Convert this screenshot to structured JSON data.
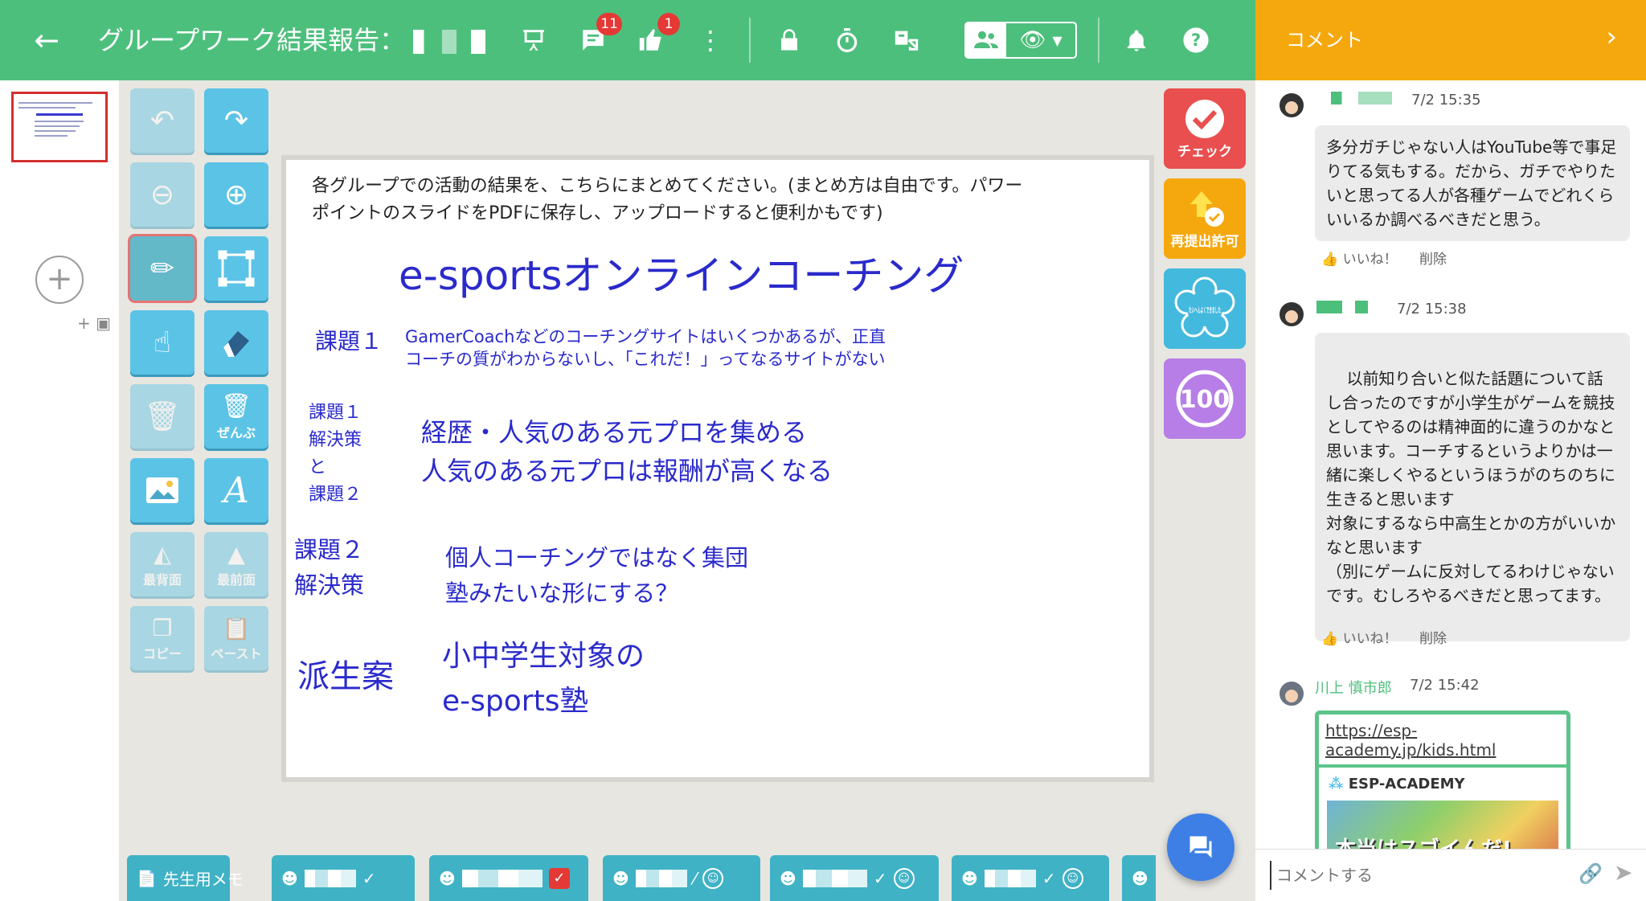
{
  "header": {
    "title": "グループワーク結果報告：",
    "comments_badge": "11",
    "likes_badge": "1",
    "panel_title": "コメント",
    "icons": [
      "back-arrow-icon",
      "presentation-icon",
      "comment-icon",
      "thumbs-up-icon",
      "more-vert-icon",
      "lock-icon",
      "timer-icon",
      "translate-off-icon",
      "group-icon",
      "eye-icon",
      "bell-icon",
      "help-icon"
    ]
  },
  "tools": {
    "delete_all": "ぜんぶ",
    "send_back": "最背面",
    "bring_front": "最前面",
    "copy": "コピー",
    "paste": "ペースト"
  },
  "right_tools": {
    "check": "チェック",
    "resubmit": "再提出許可",
    "stamp": "たいへんよくできました",
    "score": "100"
  },
  "canvas": {
    "intro_line1": "各グループでの活動の結果を、こちらにまとめてください。(まとめ方は自由です。パワー",
    "intro_line2": "ポイントのスライドをPDFに保存し、アップロードすると便利かもです)",
    "heading": "e-sportsオンラインコーチング",
    "issue1_label": "課題１",
    "issue1_line1": "GamerCoachなどのコーチングサイトはいくつかあるが、正直",
    "issue1_line2": "コーチの質がわからないし、「これだ！」ってなるサイトがない",
    "sol1_label_1": "課題１",
    "sol1_label_2": "解決策",
    "sol1_label_3": "と",
    "sol1_label_4": "課題２",
    "sol1_line1": "経歴・人気のある元プロを集める",
    "sol1_line2": "人気のある元プロは報酬が高くなる",
    "sol2_label_1": "課題２",
    "sol2_label_2": "解決策",
    "sol2_line1": "個人コーチングではなく集団",
    "sol2_line2": "塾みたいな形にする？",
    "deriv_label": "派生案",
    "deriv_line1": "小中学生対象の",
    "deriv_line2": "e-sports塾"
  },
  "comments": [
    {
      "time": "7/2 15:35",
      "text": "多分ガチじゃない人はYouTube等で事足りてる気もする。だから、ガチでやりたいと思ってる人が各種ゲームでどれくらいいるか調べるべきだと思う。",
      "like": "いいね！",
      "delete": "削除"
    },
    {
      "time": "7/2 15:38",
      "text": "以前知り合いと似た話題について話し合ったのですが小学生がゲームを競技としてやるのは精神面的に違うのかなと思います。コーチするというよりかは一緒に楽しくやるというほうがのちのちに生きると思います\n対象にするなら中高生とかの方がいいかなと思います\n（別にゲームに反対してるわけじゃないです。むしろやるべきだと思ってます。",
      "like": "いいね！",
      "delete": "削除"
    },
    {
      "name": "川上 慎市郎",
      "time": "7/2 15:42",
      "link": "https://esp-academy.jp/kids.html",
      "card_title": "ESP-ACADEMY",
      "card_image_text": "本当はスゴイんだ!"
    }
  ],
  "comment_input": {
    "placeholder": "コメントする"
  },
  "bottom_tabs": {
    "teacher_memo": "先生用メモ"
  }
}
